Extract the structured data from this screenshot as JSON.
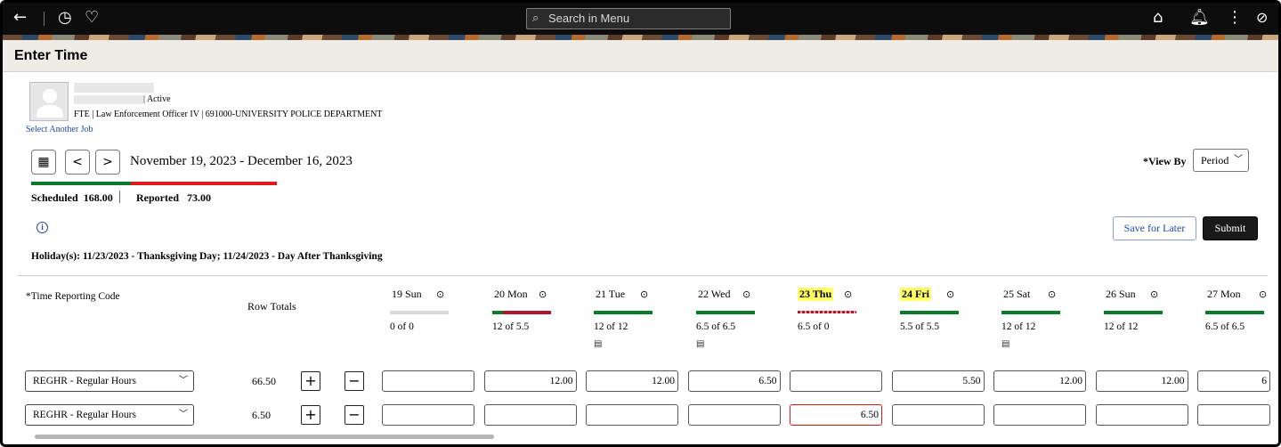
{
  "search": {
    "placeholder": "Search in Menu"
  },
  "page": {
    "title": "Enter Time"
  },
  "employee": {
    "status": "| Active",
    "job": "FTE | Law Enforcement Officer IV | 691000-UNIVERSITY POLICE DEPARTMENT",
    "select_another": "Select Another Job"
  },
  "nav": {
    "prev": "<",
    "next": ">",
    "period": "November 19, 2023 - December 16, 2023",
    "view_by_label": "*View By",
    "view_by_value": "Period"
  },
  "summary": {
    "scheduled_label": "Scheduled",
    "scheduled_value": "168.00",
    "reported_label": "Reported",
    "reported_value": "73.00",
    "scheduled_color": "#0d7a2b",
    "reported_color": "#e01a1a"
  },
  "actions": {
    "save": "Save for Later",
    "submit": "Submit"
  },
  "holiday_text": "Holiday(s): 11/23/2023 - Thanksgiving Day; 11/24/2023 - Day After Thanksgiving",
  "grid": {
    "trc_header": "*Time Reporting Code",
    "row_totals_header": "Row Totals",
    "days": [
      {
        "label": "19 Sun",
        "value": "0 of 0",
        "bar": "gray",
        "holiday": false,
        "comment": false
      },
      {
        "label": "20 Mon",
        "value": "12 of 5.5",
        "bar": "green-red",
        "holiday": false,
        "comment": false
      },
      {
        "label": "21 Tue",
        "value": "12 of 12",
        "bar": "green",
        "holiday": false,
        "comment": true
      },
      {
        "label": "22 Wed",
        "value": "6.5 of 6.5",
        "bar": "green",
        "holiday": false,
        "comment": true
      },
      {
        "label": "23 Thu",
        "value": "6.5 of 0",
        "bar": "red",
        "holiday": true,
        "comment": false
      },
      {
        "label": "24 Fri",
        "value": "5.5 of 5.5",
        "bar": "green",
        "holiday": true,
        "comment": false
      },
      {
        "label": "25 Sat",
        "value": "12 of 12",
        "bar": "green",
        "holiday": false,
        "comment": true
      },
      {
        "label": "26 Sun",
        "value": "12 of 12",
        "bar": "green",
        "holiday": false,
        "comment": false
      },
      {
        "label": "27 Mon",
        "value": "6.5 of 6.5",
        "bar": "green",
        "holiday": false,
        "comment": false
      }
    ],
    "rows": [
      {
        "trc": "REGHR - Regular Hours",
        "total": "66.50",
        "cells": [
          "",
          "12.00",
          "12.00",
          "6.50",
          "",
          "5.50",
          "12.00",
          "12.00",
          "6"
        ]
      },
      {
        "trc": "REGHR - Regular Hours",
        "total": "6.50",
        "cells": [
          "",
          "",
          "",
          "",
          "6.50",
          "",
          "",
          "",
          ""
        ]
      }
    ],
    "error_cell": {
      "row": 1,
      "day": 4
    }
  }
}
